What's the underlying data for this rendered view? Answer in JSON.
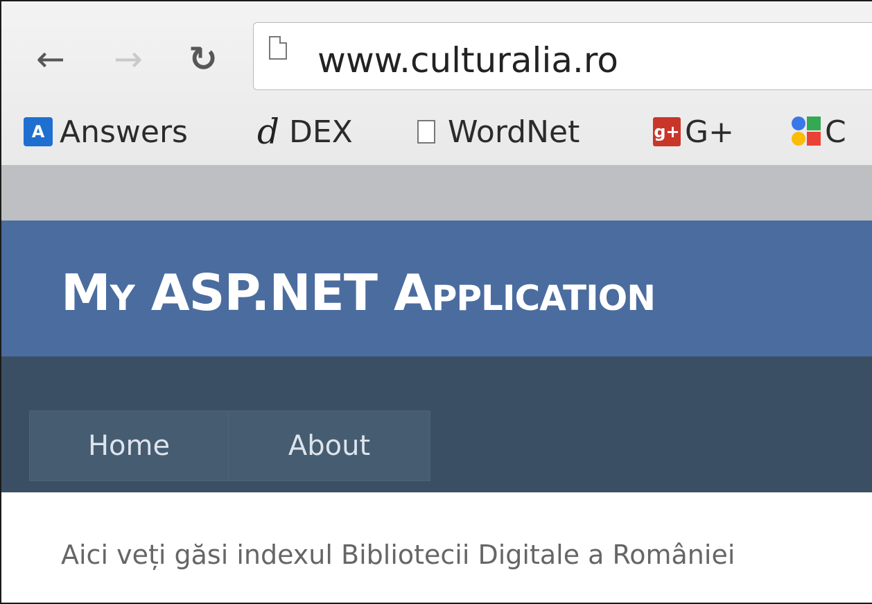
{
  "browser": {
    "url": "www.culturalia.ro",
    "bookmarks": [
      {
        "label": "Answers",
        "icon": "answers-icon",
        "icon_text": "A"
      },
      {
        "label": "DEX",
        "icon": "dex-icon",
        "icon_text": "d"
      },
      {
        "label": "WordNet",
        "icon": "page-icon"
      },
      {
        "label": "G+",
        "icon": "google-plus-icon",
        "icon_text": "g+"
      },
      {
        "label": "C",
        "icon": "google-apps-icon"
      }
    ]
  },
  "site": {
    "title": "My ASP.NET Application",
    "menu": [
      "Home",
      "About"
    ],
    "body_text": "Aici veți găsi indexul Bibliotecii Digitale a României"
  },
  "colors": {
    "header_bg": "#4b6c9e",
    "menubar_bg": "#3a4f63",
    "menu_item_bg": "#465c71"
  }
}
